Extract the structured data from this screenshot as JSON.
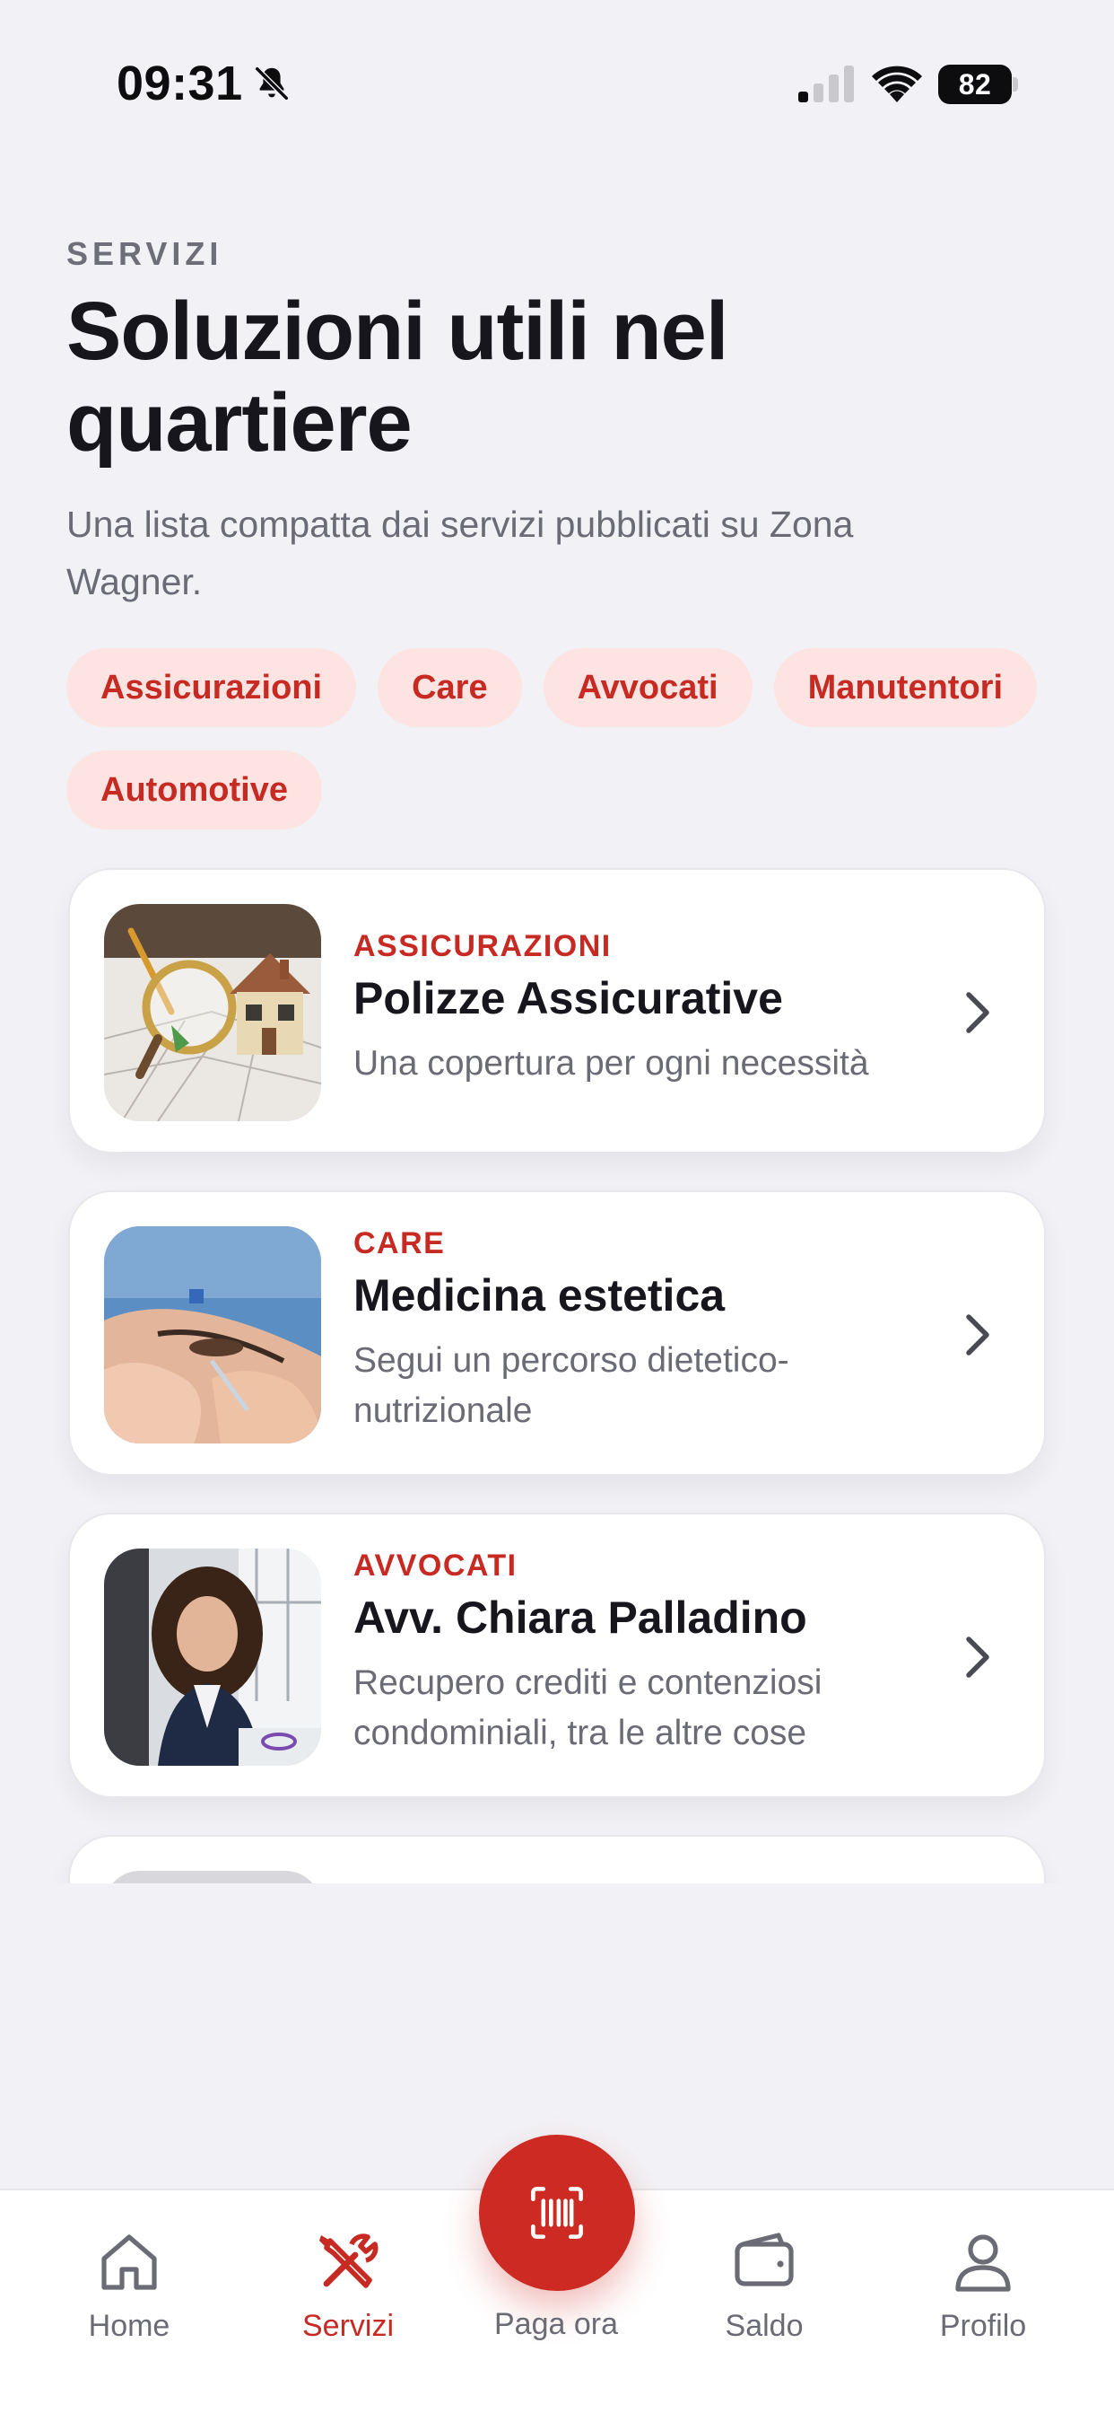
{
  "status_bar": {
    "time": "09:31",
    "battery": "82",
    "icons": [
      "bell-off-icon",
      "signal-icon",
      "wifi-icon",
      "battery-icon"
    ]
  },
  "header": {
    "eyebrow": "SERVIZI",
    "title": "Soluzioni utili nel quartiere",
    "subtitle": "Una lista compatta dai servizi pubblicati su Zona Wagner."
  },
  "chips": [
    "Assicurazioni",
    "Care",
    "Avvocati",
    "Manutentori",
    "Automotive"
  ],
  "services": [
    {
      "category": "ASSICURAZIONI",
      "title": "Polizze Assicurative",
      "description": "Una copertura per ogni necessità",
      "image": "house-model-magnifier-photo"
    },
    {
      "category": "CARE",
      "title": "Medicina estetica",
      "description": "Segui un percorso dietetico-nutrizionale",
      "image": "aesthetic-treatment-photo"
    },
    {
      "category": "AVVOCATI",
      "title": "Avv. Chiara Palladino",
      "description": "Recupero crediti e contenziosi condominiali, tra le altre cose",
      "image": "lawyer-portrait-photo"
    }
  ],
  "tabbar": {
    "home": "Home",
    "servizi": "Servizi",
    "pay": "Paga ora",
    "saldo": "Saldo",
    "profilo": "Profilo",
    "active": "servizi"
  },
  "colors": {
    "accent": "#c62a22",
    "chip_bg": "#fde4e2",
    "background": "#f2f2f6",
    "text_primary": "#16161c",
    "text_secondary": "#6b6b75"
  }
}
